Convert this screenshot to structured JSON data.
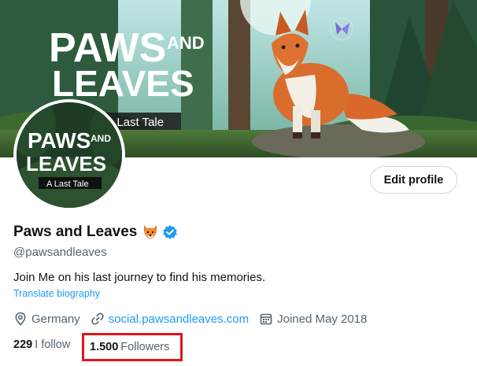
{
  "banner": {
    "logo_line1": "PAWS",
    "logo_and": "AND",
    "logo_line2": "LEAVES",
    "tagline": "A Last Tale"
  },
  "avatar": {
    "logo_line1": "PAWS",
    "logo_and": "AND",
    "logo_line2": "LEAVES",
    "tagline": "A Last Tale"
  },
  "profile": {
    "edit_button": "Edit profile",
    "name": "Paws and Leaves",
    "handle": "@pawsandleaves",
    "bio": "Join Me on his last journey to find his memories.",
    "translate_link": "Translate biography",
    "location": "Germany",
    "website": "social.pawsandleaves.com",
    "joined": "Joined May 2018",
    "following_count": "229",
    "following_label": "I follow",
    "followers_count": "1.500",
    "followers_label": "Followers"
  },
  "colors": {
    "accent": "#1d9bf0",
    "highlight_box": "#e0141e",
    "secondary_text": "#536471"
  },
  "icons": [
    "fox-emoji-icon",
    "verified-badge-icon",
    "location-pin-icon",
    "link-icon",
    "calendar-icon"
  ]
}
